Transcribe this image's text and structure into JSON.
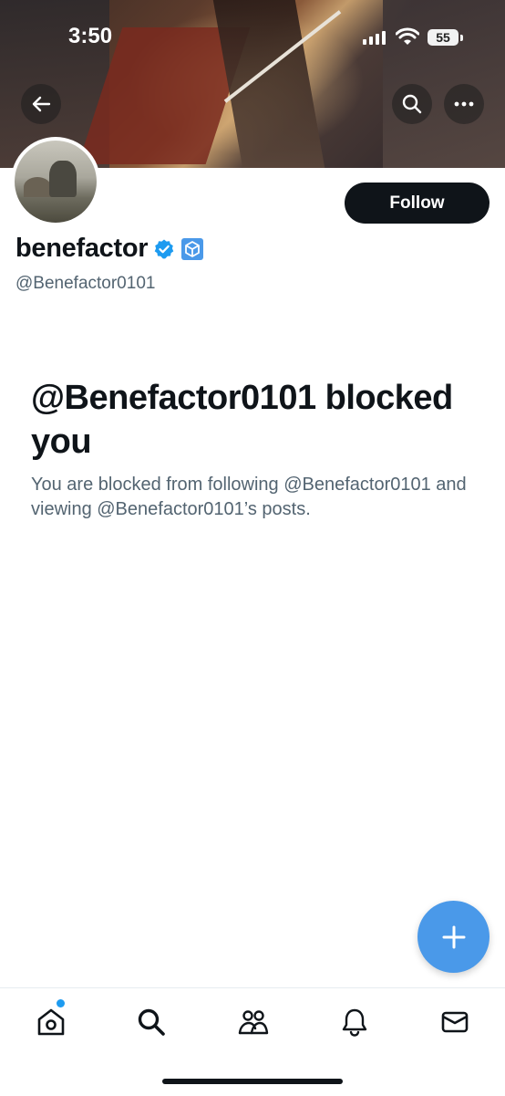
{
  "status_bar": {
    "time": "3:50",
    "battery": "55"
  },
  "profile": {
    "display_name": "benefactor",
    "handle": "@Benefactor0101",
    "follow_label": "Follow"
  },
  "blocked": {
    "title": "@Benefactor0101 blocked you",
    "message": "You are blocked from following @Benefactor0101 and viewing @Benefactor0101’s posts."
  },
  "nav": {
    "items": [
      "home-icon",
      "search-icon",
      "communities-icon",
      "notifications-icon",
      "messages-icon"
    ],
    "home_has_notification_dot": true
  },
  "colors": {
    "accent": "#1d9bf0",
    "fab": "#4a99e9",
    "text_primary": "#0f1419",
    "text_secondary": "#536471"
  }
}
